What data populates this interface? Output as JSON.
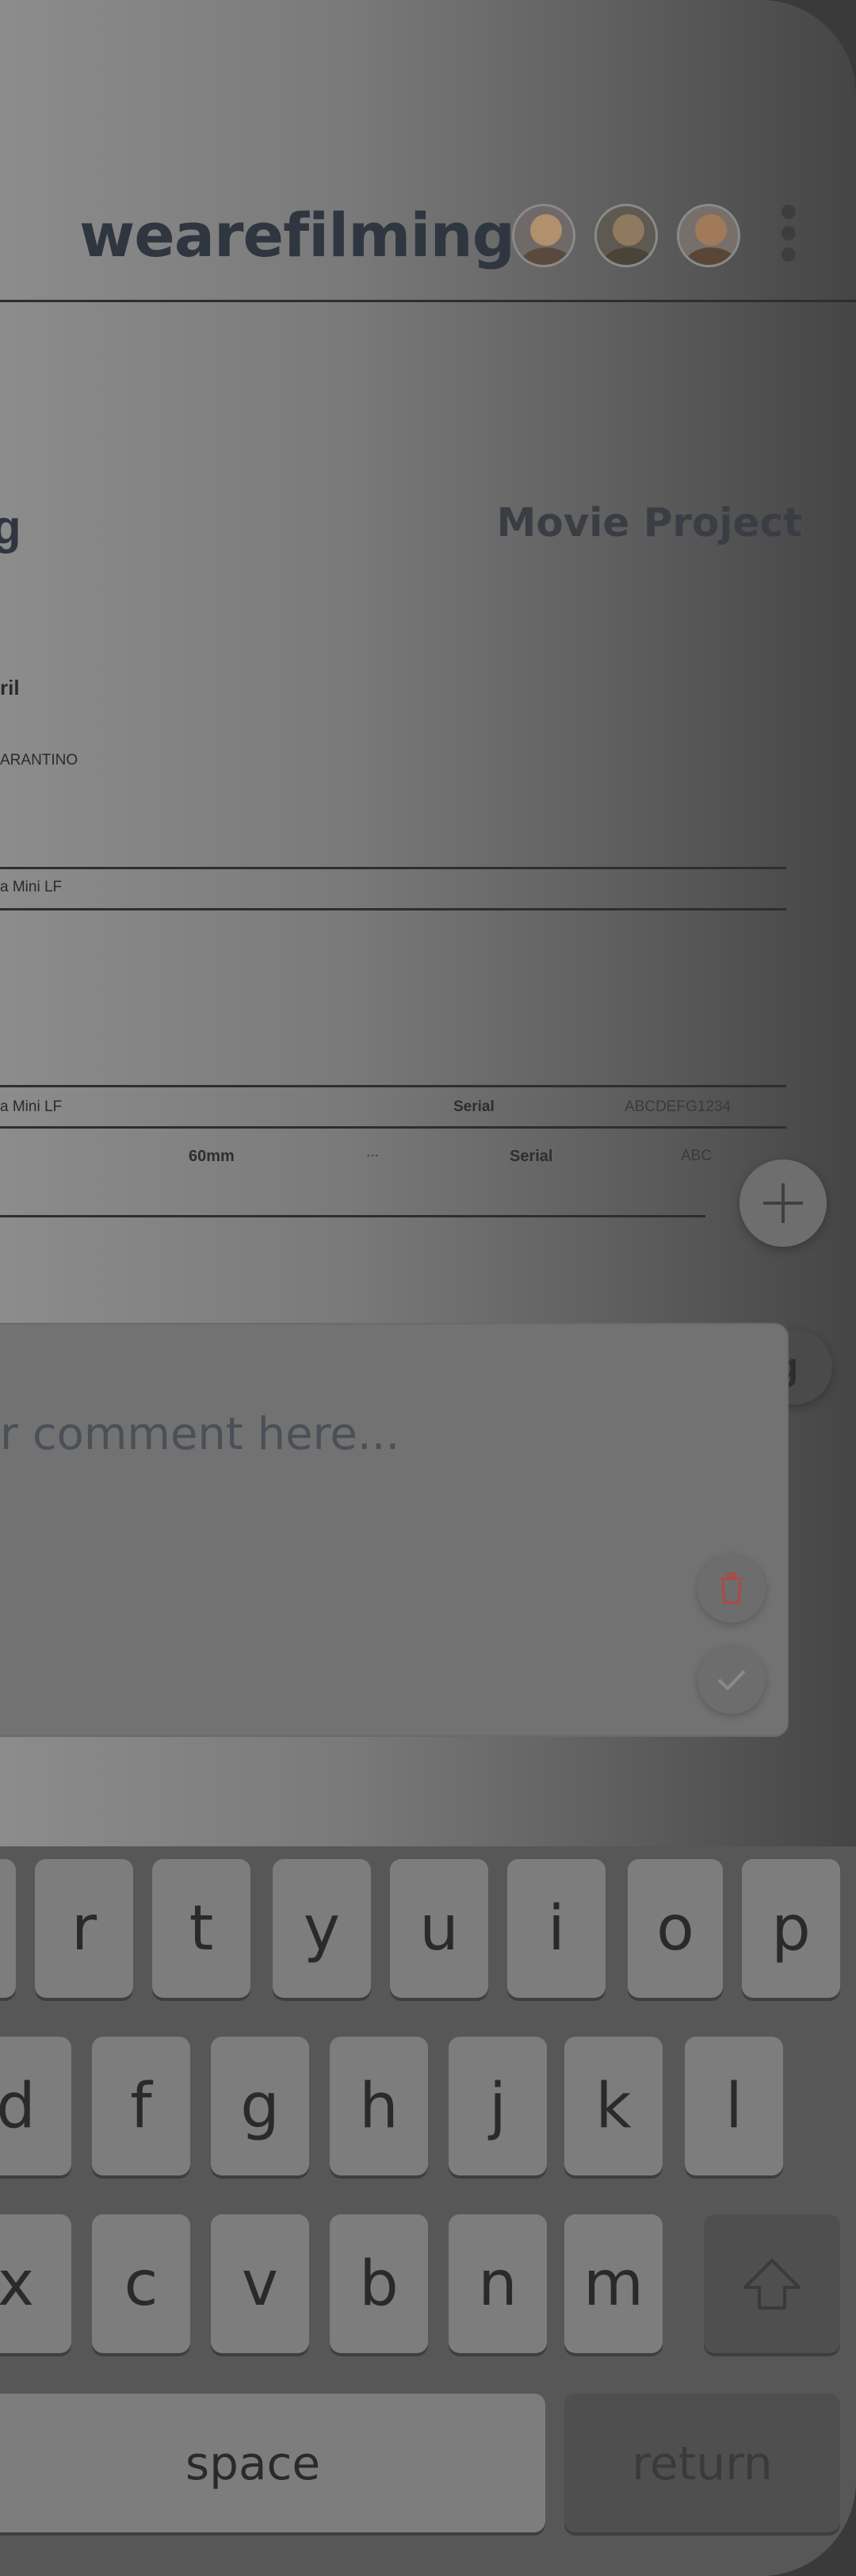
{
  "app": {
    "brand": "wearefilming",
    "project_label": "Movie Project"
  },
  "avatars": [
    {
      "name": "avatar-woman-blonde",
      "head": "#b28f6d",
      "body": "#5a4a3e",
      "bg": "#6f6a68"
    },
    {
      "name": "avatar-woman-dark",
      "head": "#8f7a60",
      "body": "#4a4438",
      "bg": "#5e5a52"
    },
    {
      "name": "avatar-man-glasses",
      "head": "#a07a58",
      "body": "#5a4636",
      "bg": "#77706a"
    }
  ],
  "details": {
    "title_partial": "g",
    "line1": "ril",
    "line2": "ARANTINO",
    "row1": "a Mini LF",
    "row2": "a Mini LF",
    "serial_label": "Serial",
    "serial_value": "ABCDEFG1234",
    "lens": "60mm",
    "dots": "...",
    "serial_label2": "Serial",
    "serial_value2": "ABC"
  },
  "comment": {
    "placeholder": "r comment here..."
  },
  "fab_g_label": "g",
  "keyboard": {
    "row1": [
      "r",
      "t",
      "y",
      "u",
      "i",
      "o",
      "p"
    ],
    "row2": [
      "d",
      "f",
      "g",
      "h",
      "j",
      "k",
      "l"
    ],
    "row3": [
      "x",
      "c",
      "v",
      "b",
      "n",
      "m"
    ],
    "space": "space",
    "return": "return"
  },
  "colors": {
    "trash": "#b04848",
    "check": "#8a8a8a"
  }
}
